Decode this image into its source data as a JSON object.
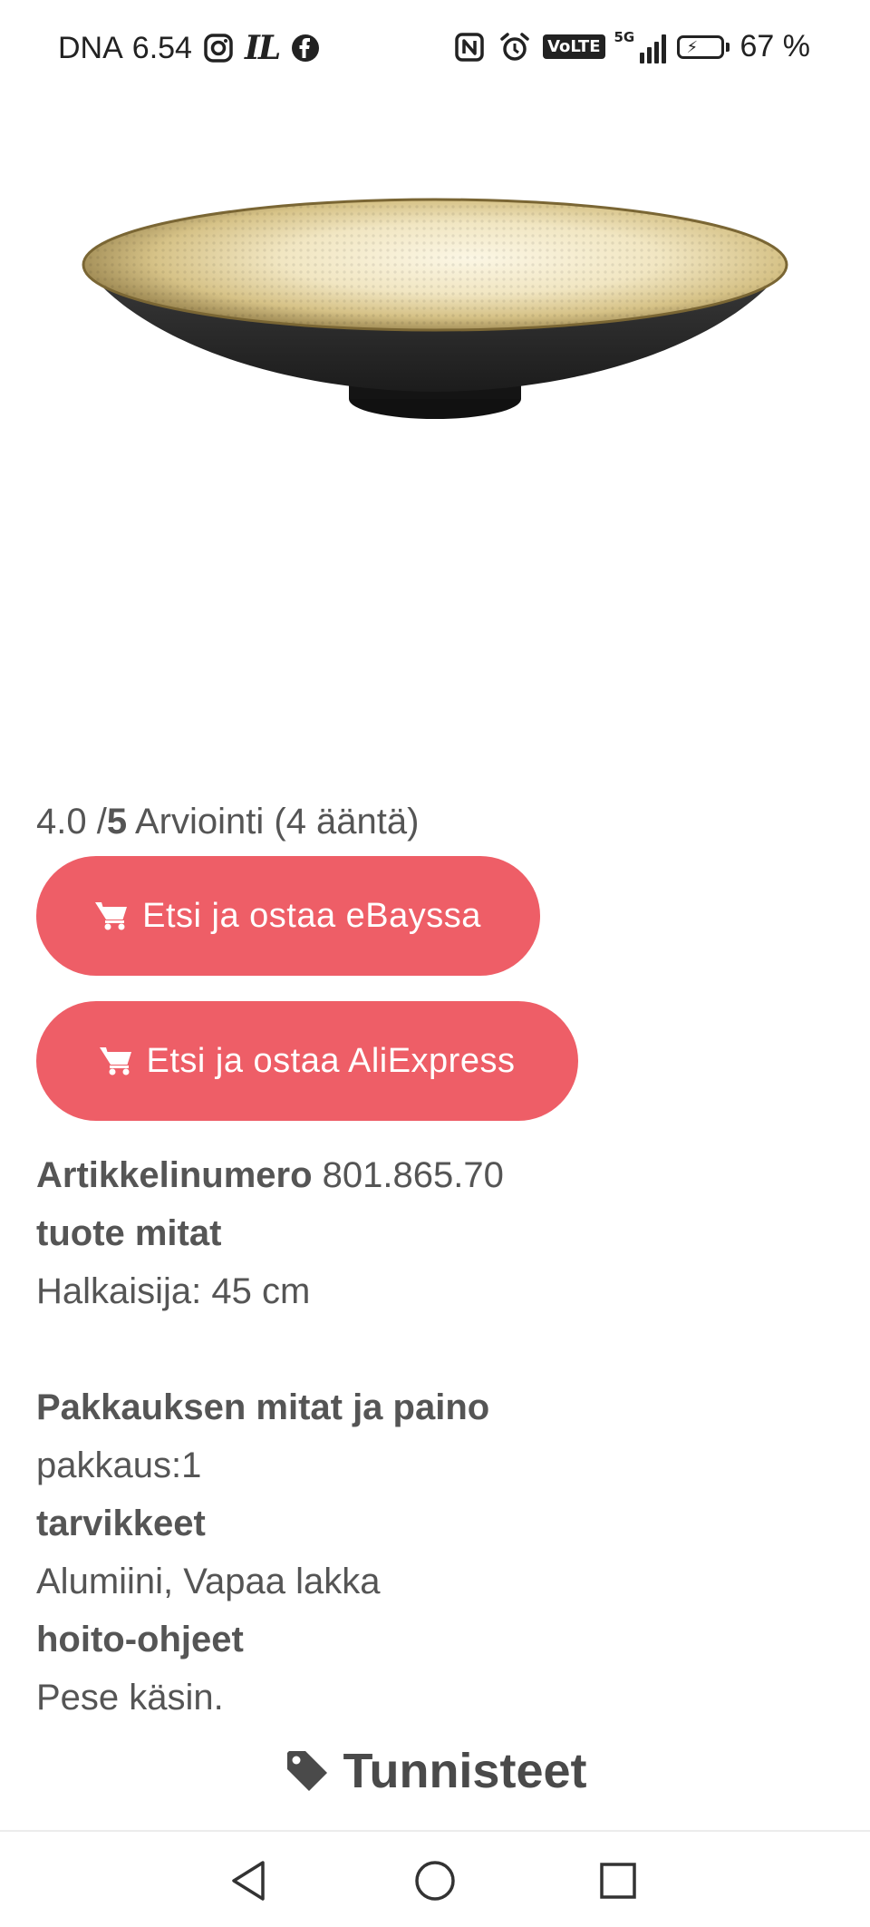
{
  "status_bar": {
    "carrier": "DNA",
    "time": "6.54",
    "il_logo": "IL",
    "volte": "VoLTE",
    "network": "5G",
    "battery": "67 %"
  },
  "product": {
    "image_icon": "gold-black-bowl-image",
    "rating_score": "4.0 /",
    "rating_max": "5",
    "rating_text": " Arviointi (4 ääntä)",
    "buttons": {
      "ebay": "Etsi ja ostaa eBayssa",
      "aliexpress": "Etsi ja ostaa AliExpress"
    },
    "details": {
      "article_label": "Artikkelinumero",
      "article_value": " 801.865.70",
      "dimensions_label": "tuote mitat",
      "dimensions_value": "Halkaisija: 45 cm",
      "package_label": "Pakkauksen mitat ja paino",
      "package_value": "pakkaus:1",
      "materials_label": "tarvikkeet",
      "materials_value": "Alumiini, Vapaa lakka",
      "care_label": "hoito-ohjeet",
      "care_value": "Pese käsin."
    },
    "tags_heading": "Tunnisteet"
  },
  "colors": {
    "button_bg": "#ee5e67",
    "text": "#555555",
    "heading": "#4a4a4a"
  },
  "navigation": {
    "icons": [
      "back-icon",
      "home-icon",
      "recent-apps-icon"
    ]
  }
}
